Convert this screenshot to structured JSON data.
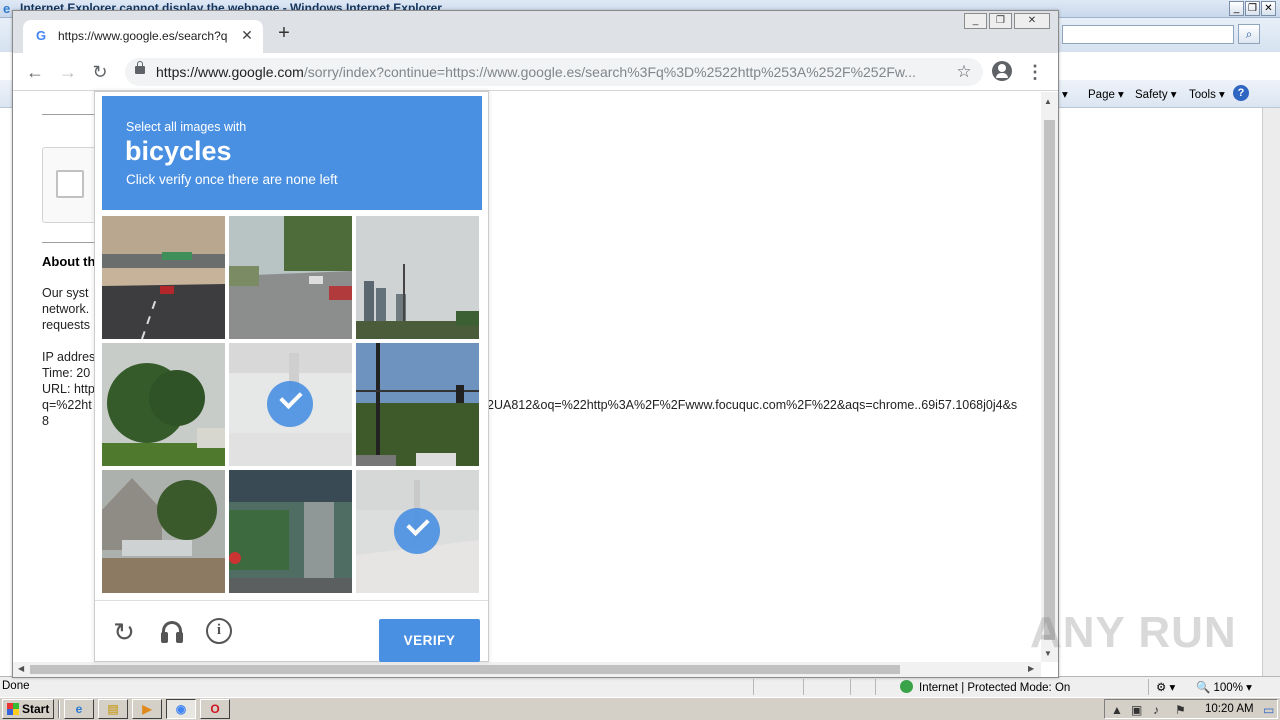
{
  "ie": {
    "title": "Internet Explorer cannot display the webpage - Windows Internet Explorer",
    "commands": [
      "Page ▾",
      "Safety ▾",
      "Tools ▾"
    ],
    "status_left": "Done",
    "status_zone": "Internet | Protected Mode: On",
    "zoom": "100%"
  },
  "chrome": {
    "tab_title": "https://www.google.es/search?q=%",
    "url_host": "https://www.google.com",
    "url_path": "/sorry/index?continue=https://www.google.es/search%3Fq%3D%2522http%253A%252F%252Fw..."
  },
  "page": {
    "about_heading": "About th",
    "paragraph_lines": [
      "Our syst",
      "network.",
      "requests"
    ],
    "info_lines": [
      "IP addres",
      "Time: 20",
      "URL: http",
      "q=%22ht",
      "8"
    ],
    "url_tail": "2UA812&oq=%22http%3A%2F%2Fwww.focuquc.com%2F%22&aqs=chrome..69i57.1068j0j4&s"
  },
  "captcha": {
    "instruction": "Select all images with",
    "keyword": "bicycles",
    "subtext": "Click verify once there are none left",
    "verify_label": "VERIFY",
    "tiles": [
      {
        "scene": "highway-overpass",
        "selected": false
      },
      {
        "scene": "street-cars",
        "selected": false
      },
      {
        "scene": "city-buildings",
        "selected": false
      },
      {
        "scene": "tree",
        "selected": false
      },
      {
        "scene": "faded-street",
        "selected": true
      },
      {
        "scene": "traffic-lights",
        "selected": false
      },
      {
        "scene": "house-car",
        "selected": false
      },
      {
        "scene": "bridge-underpass",
        "selected": false
      },
      {
        "scene": "sidewalk",
        "selected": true
      }
    ]
  },
  "watermark": "ANY RUN",
  "taskbar": {
    "start_label": "Start",
    "clock": "10:20 AM"
  }
}
